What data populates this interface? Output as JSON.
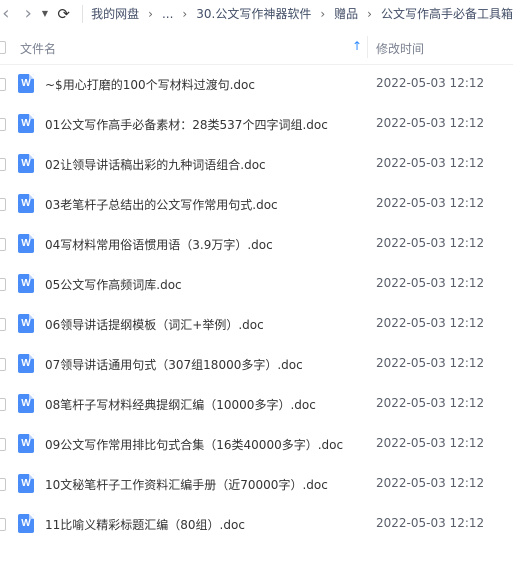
{
  "toolbar": {
    "back_icon": "‹",
    "forward_icon": "›",
    "dropdown_icon": "▼",
    "refresh_icon": "⟳",
    "breadcrumb": [
      "我的网盘",
      "...",
      "30.公文写作神器软件",
      "赠品",
      "公文写作高手必备工具箱"
    ],
    "separator": "›"
  },
  "header": {
    "name_label": "文件名",
    "sort_icon": "↑",
    "time_label": "修改时间"
  },
  "files": [
    {
      "name": "~$用心打磨的100个写材料过渡句.doc",
      "modified": "2022-05-03 12:12",
      "icon": "W"
    },
    {
      "name": "01公文写作高手必备素材：28类537个四字词组.doc",
      "modified": "2022-05-03 12:12",
      "icon": "W"
    },
    {
      "name": "02让领导讲话稿出彩的九种词语组合.doc",
      "modified": "2022-05-03 12:12",
      "icon": "W"
    },
    {
      "name": "03老笔杆子总结出的公文写作常用句式.doc",
      "modified": "2022-05-03 12:12",
      "icon": "W"
    },
    {
      "name": "04写材料常用俗语惯用语（3.9万字）.doc",
      "modified": "2022-05-03 12:12",
      "icon": "W"
    },
    {
      "name": "05公文写作高频词库.doc",
      "modified": "2022-05-03 12:12",
      "icon": "W"
    },
    {
      "name": "06领导讲话提纲模板（词汇+举例）.doc",
      "modified": "2022-05-03 12:12",
      "icon": "W"
    },
    {
      "name": "07领导讲话通用句式（307组18000多字）.doc",
      "modified": "2022-05-03 12:12",
      "icon": "W"
    },
    {
      "name": "08笔杆子写材料经典提纲汇编（10000多字）.doc",
      "modified": "2022-05-03 12:12",
      "icon": "W"
    },
    {
      "name": "09公文写作常用排比句式合集（16类40000多字）.doc",
      "modified": "2022-05-03 12:12",
      "icon": "W"
    },
    {
      "name": "10文秘笔杆子工作资料汇编手册（近70000字）.doc",
      "modified": "2022-05-03 12:12",
      "icon": "W"
    },
    {
      "name": "11比喻义精彩标题汇编（80组）.doc",
      "modified": "2022-05-03 12:12",
      "icon": "W"
    }
  ]
}
